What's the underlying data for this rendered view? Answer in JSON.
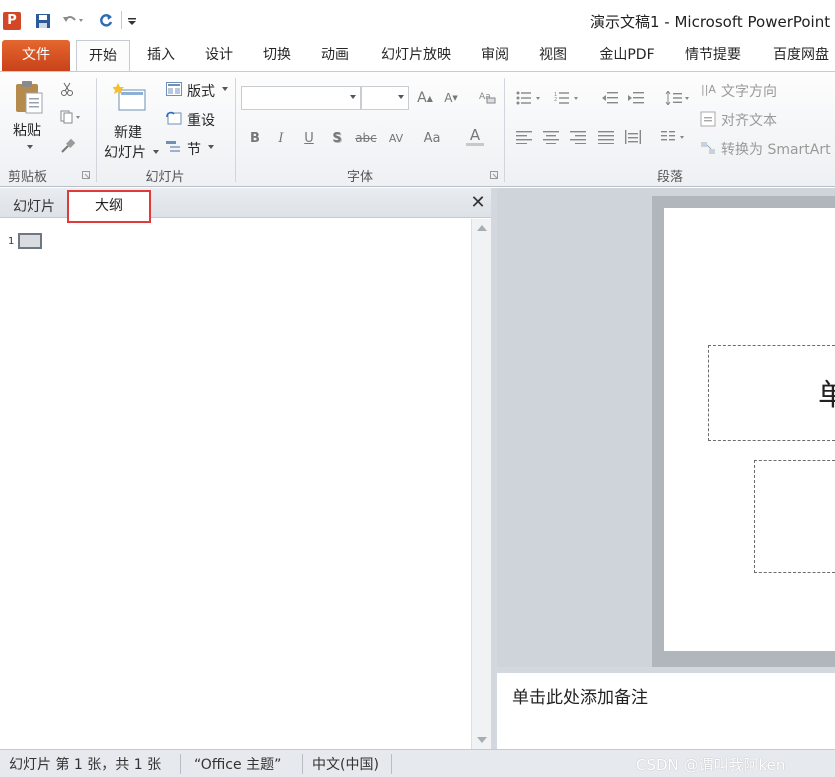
{
  "window": {
    "title": "演示文稿1 - Microsoft PowerPoint",
    "app_icon": "powerpoint-icon",
    "app_icon_letter": "P",
    "quick_access": [
      "save-icon",
      "undo-icon",
      "redo-icon",
      "customize-icon"
    ]
  },
  "ribbon_tabs": [
    {
      "label": "文件"
    },
    {
      "label": "开始"
    },
    {
      "label": "插入"
    },
    {
      "label": "设计"
    },
    {
      "label": "切换"
    },
    {
      "label": "动画"
    },
    {
      "label": "幻灯片放映"
    },
    {
      "label": "审阅"
    },
    {
      "label": "视图"
    },
    {
      "label": "金山PDF"
    },
    {
      "label": "情节提要"
    },
    {
      "label": "百度网盘"
    }
  ],
  "ribbon": {
    "clipboard": {
      "group_label": "剪贴板",
      "paste_label": "粘贴"
    },
    "slides": {
      "group_label": "幻灯片",
      "new_slide_line1": "新建",
      "new_slide_line2": "幻灯片",
      "layout_label": "版式",
      "reset_label": "重设",
      "section_label": "节"
    },
    "font": {
      "group_label": "字体",
      "font_name": "",
      "font_size": "",
      "bold": "B",
      "italic": "I",
      "underline": "U",
      "shadow": "S",
      "strike": "abc",
      "spacing": "AV",
      "case": "Aa",
      "color": "A"
    },
    "paragraph": {
      "group_label": "段落",
      "text_direction_label": "文字方向",
      "align_text_label": "对齐文本",
      "smartart_label": "转换为 SmartArt"
    }
  },
  "left_pane": {
    "tabs": [
      {
        "label": "幻灯片"
      },
      {
        "label": "大纲"
      }
    ],
    "active_tab": "大纲",
    "outline_slide_number": "1"
  },
  "slide": {
    "title_placeholder_char": "单"
  },
  "notes": {
    "placeholder": "单击此处添加备注"
  },
  "status_bar": {
    "slide_info": "幻灯片 第 1 张，共 1 张",
    "theme": "“Office 主题”",
    "language": "中文(中国)",
    "watermark": "CSDN @谓叫我阿ken"
  },
  "colors": {
    "file_tab": "#d9512a",
    "highlight_border": "#e03a3a",
    "ribbon_bg": "#f3f4f6"
  }
}
